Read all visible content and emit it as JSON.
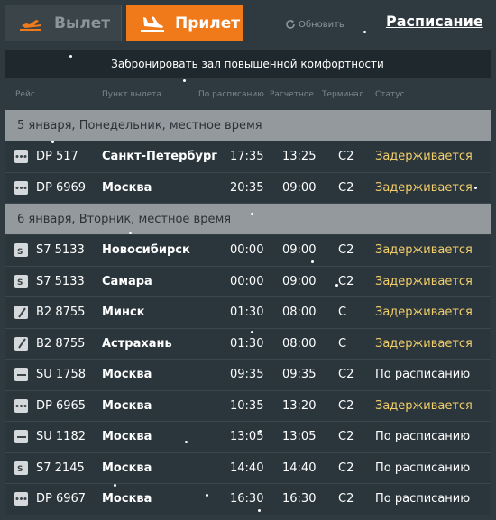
{
  "tabs": {
    "departure": "Вылет",
    "arrival": "Прилет"
  },
  "refresh_label": "Обновить",
  "schedule_link": "Расписание",
  "banner": "Забронировать зал повышенной комфортности",
  "columns": [
    "Рейс",
    "Пункт вылета",
    "По расписанию",
    "Расчетное",
    "Терминал",
    "Статус"
  ],
  "groups": [
    {
      "label": "5 января, Понедельник, местное время",
      "flights": [
        {
          "logo": "dp-logo-icon",
          "flight": "DP 517",
          "city": "Санкт-Петербург",
          "scheduled": "17:35",
          "estimated": "13:25",
          "terminal": "C2",
          "status": "Задерживается",
          "status_type": "delayed"
        },
        {
          "logo": "dp-logo-icon",
          "flight": "DP 6969",
          "city": "Москва",
          "scheduled": "20:35",
          "estimated": "09:00",
          "terminal": "C2",
          "status": "Задерживается",
          "status_type": "delayed"
        }
      ]
    },
    {
      "label": "6 января, Вторник, местное время",
      "flights": [
        {
          "logo": "s7-logo-icon",
          "flight": "S7 5133",
          "city": "Новосибирск",
          "scheduled": "00:00",
          "estimated": "09:00",
          "terminal": "C2",
          "status": "Задерживается",
          "status_type": "delayed"
        },
        {
          "logo": "s7-logo-icon",
          "flight": "S7 5133",
          "city": "Самара",
          "scheduled": "00:00",
          "estimated": "09:00",
          "terminal": "C2",
          "status": "Задерживается",
          "status_type": "delayed"
        },
        {
          "logo": "b2-logo-icon",
          "flight": "B2 8755",
          "city": "Минск",
          "scheduled": "01:30",
          "estimated": "08:00",
          "terminal": "C",
          "status": "Задерживается",
          "status_type": "delayed"
        },
        {
          "logo": "b2-logo-icon",
          "flight": "B2 8755",
          "city": "Астрахань",
          "scheduled": "01:30",
          "estimated": "08:00",
          "terminal": "C",
          "status": "Задерживается",
          "status_type": "delayed"
        },
        {
          "logo": "su-logo-icon",
          "flight": "SU 1758",
          "city": "Москва",
          "scheduled": "09:35",
          "estimated": "09:35",
          "terminal": "C2",
          "status": "По расписанию",
          "status_type": "ontime"
        },
        {
          "logo": "dp-logo-icon",
          "flight": "DP 6965",
          "city": "Москва",
          "scheduled": "10:35",
          "estimated": "13:20",
          "terminal": "C2",
          "status": "Задерживается",
          "status_type": "delayed"
        },
        {
          "logo": "su-logo-icon",
          "flight": "SU 1182",
          "city": "Москва",
          "scheduled": "13:05",
          "estimated": "13:05",
          "terminal": "C2",
          "status": "По расписанию",
          "status_type": "ontime"
        },
        {
          "logo": "s7-logo-icon",
          "flight": "S7 2145",
          "city": "Москва",
          "scheduled": "14:40",
          "estimated": "14:40",
          "terminal": "C2",
          "status": "По расписанию",
          "status_type": "ontime"
        },
        {
          "logo": "dp-logo-icon",
          "flight": "DP 6967",
          "city": "Москва",
          "scheduled": "16:30",
          "estimated": "16:30",
          "terminal": "C2",
          "status": "По расписанию",
          "status_type": "ontime"
        }
      ]
    }
  ],
  "colors": {
    "accent": "#f07a19",
    "delayed": "#f2cf6b",
    "background": "#2f3a40"
  }
}
